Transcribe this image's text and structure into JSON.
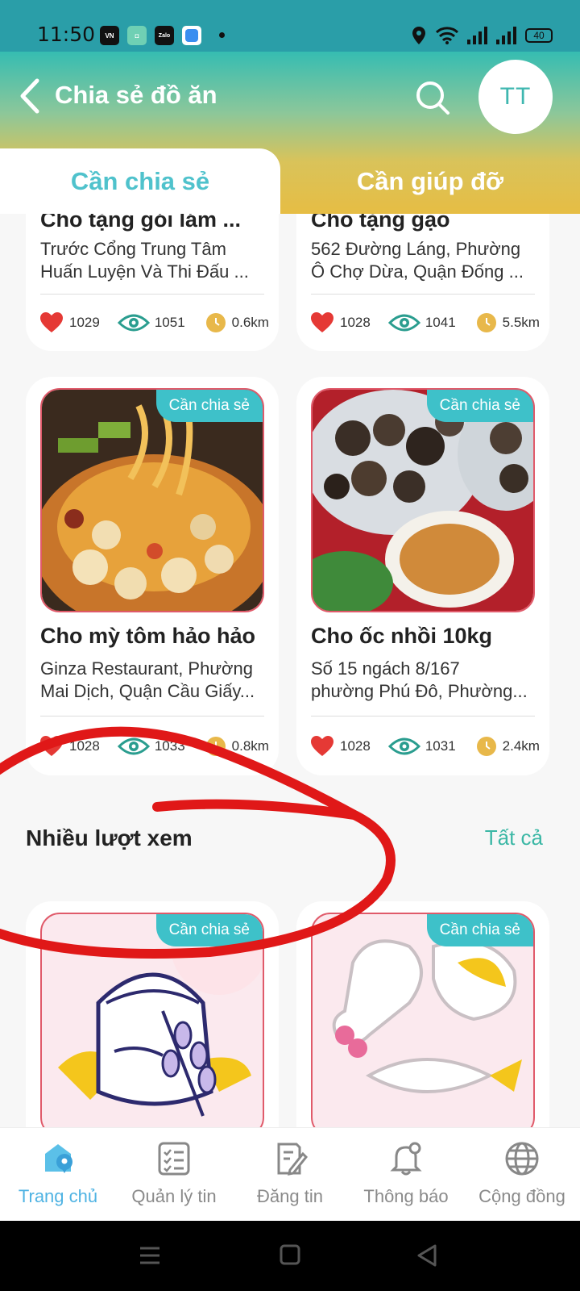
{
  "status": {
    "time": "11:50",
    "battery": "40",
    "apps": [
      "VN",
      "zalo-mini",
      "Zalo",
      "blue-app"
    ]
  },
  "header": {
    "title": "Chia sẻ đồ ăn",
    "avatar_initials": "TT"
  },
  "tabs": [
    {
      "label": "Cần chia sẻ",
      "active": true
    },
    {
      "label": "Cần giúp đỡ",
      "active": false
    }
  ],
  "cards_top": [
    {
      "title": "Cho tặng gói lám ...",
      "address": [
        "Trước Cổng Trung Tâm",
        "Huấn Luyện Và Thi Đấu ..."
      ],
      "likes": "1029",
      "views": "1051",
      "distance": "0.6km"
    },
    {
      "title": "Cho tặng gạo",
      "address": [
        "562 Đường Láng, Phường",
        "Ô Chợ Dừa, Quận Đống ..."
      ],
      "likes": "1028",
      "views": "1041",
      "distance": "5.5km"
    },
    {
      "badge": "Cần chia sẻ",
      "title": "Cho mỳ tôm hảo hảo",
      "address": [
        "Ginza Restaurant, Phường",
        "Mai Dịch, Quận Cầu Giấy..."
      ],
      "likes": "1028",
      "views": "1033",
      "distance": "0.8km"
    },
    {
      "badge": "Cần chia sẻ",
      "title": "Cho ốc nhồi 10kg",
      "address": [
        "Số 15 ngách 8/167",
        "phường Phú Đô, Phường..."
      ],
      "likes": "1028",
      "views": "1031",
      "distance": "2.4km"
    }
  ],
  "section": {
    "title": "Nhiều lượt xem",
    "all_label": "Tất cả"
  },
  "cards_bottom": [
    {
      "badge": "Cần chia sẻ"
    },
    {
      "badge": "Cần chia sẻ"
    }
  ],
  "bottom_nav": [
    {
      "label": "Trang chủ",
      "icon": "home-location-icon",
      "active": true
    },
    {
      "label": "Quản lý tin",
      "icon": "checklist-icon",
      "active": false
    },
    {
      "label": "Đăng tin",
      "icon": "edit-document-icon",
      "active": false
    },
    {
      "label": "Thông báo",
      "icon": "bell-icon",
      "active": false
    },
    {
      "label": "Cộng đồng",
      "icon": "globe-icon",
      "active": false
    }
  ],
  "colors": {
    "accent": "#3ec1c9",
    "heart": "#e53935",
    "eye": "#2a9d8f",
    "clock": "#e8b84a",
    "annotation": "#e01818"
  }
}
